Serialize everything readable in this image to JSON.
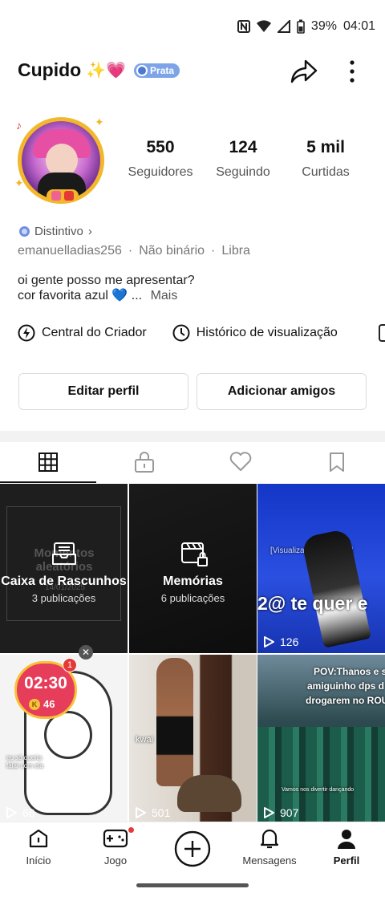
{
  "status_bar": {
    "battery": "39%",
    "time": "04:01"
  },
  "profile": {
    "name": "Cupido",
    "name_emoji": "✨💗",
    "tier_badge": "Prata",
    "stats": [
      {
        "value": "550",
        "label": "Seguidores"
      },
      {
        "value": "124",
        "label": "Seguindo"
      },
      {
        "value": "5 mil",
        "label": "Curtidas"
      }
    ],
    "distintivo": "Distintivo",
    "meta": [
      "emanuelladias256",
      "·",
      "Não binário",
      "·",
      "Libra"
    ],
    "bio_line1": "oi gente posso me apresentar?",
    "bio_line2": "cor favorita azul",
    "bio_heart": "💙",
    "bio_ellipsis": "...",
    "bio_more": "Mais"
  },
  "tools": [
    {
      "label": "Central do Criador",
      "icon": "bolt-icon"
    },
    {
      "label": "Histórico de visualização",
      "icon": "clock-icon"
    }
  ],
  "buttons": {
    "edit": "Editar perfil",
    "add_friends": "Adicionar amigos"
  },
  "tabs": [
    "grid-icon",
    "lock-icon",
    "heart-icon",
    "bookmark-icon"
  ],
  "grid": {
    "drafts": {
      "title": "Caixa de Rascunhos",
      "sub": "3 publicações",
      "bg_text": "Momentos aleatórios",
      "bg_date": "14/01/2025"
    },
    "memories": {
      "title": "Memórias",
      "sub": "6 publicações"
    },
    "video3": {
      "views": "126",
      "overlay1": "[Visualização de Emoji]",
      "overlay2": "2@ te quer e"
    },
    "video4": {
      "views": "66",
      "overlay": "eu só queria falar com ela"
    },
    "video5": {
      "views": "501",
      "overlay": "kwai"
    },
    "video6": {
      "views": "907",
      "overlay1": "POV:Thanos e s",
      "overlay2": "amiguinho dps d",
      "overlay3": "drogarem no ROU",
      "overlay4": "Vamos nos divertir dançando"
    }
  },
  "widget": {
    "time": "02:30",
    "coins": "46",
    "badge": "1"
  },
  "bottom_nav": [
    {
      "label": "Início",
      "icon": "home-icon"
    },
    {
      "label": "Jogo",
      "icon": "gamepad-icon"
    },
    {
      "label": "",
      "icon": "plus-icon"
    },
    {
      "label": "Mensagens",
      "icon": "bell-icon"
    },
    {
      "label": "Perfil",
      "icon": "person-icon"
    }
  ],
  "colors": {
    "gold": "#f2b72a",
    "prata": "#7da3e8",
    "red": "#e53935",
    "blue_heart": "#3d8ee6"
  }
}
